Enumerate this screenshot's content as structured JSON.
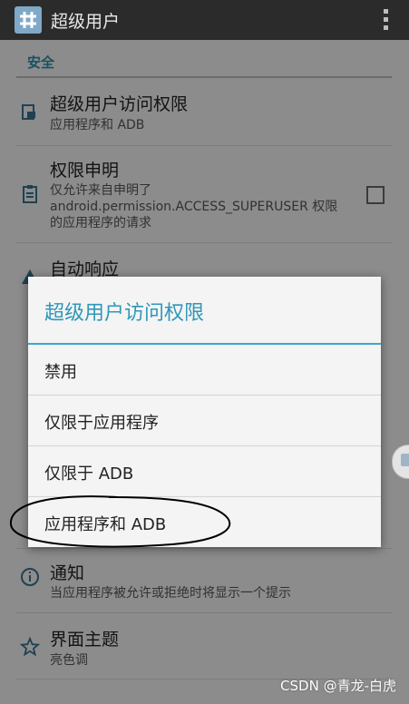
{
  "app_title": "超级用户",
  "section": "安全",
  "prefs": [
    {
      "title": "超级用户访问权限",
      "summary": "应用程序和 ADB"
    },
    {
      "title": "权限申明",
      "summary_lines": [
        "仅允许来自申明了",
        "android.permission.ACCESS_SUPERUSER 权限",
        "的应用程序的请求"
      ]
    },
    {
      "title": "自动响应"
    },
    {
      "title": "通知",
      "summary": "当应用程序被允许或拒绝时将显示一个提示"
    },
    {
      "title": "界面主题",
      "summary": "亮色调"
    }
  ],
  "dialog": {
    "title": "超级用户访问权限",
    "options": [
      "禁用",
      "仅限于应用程序",
      "仅限于 ADB",
      "应用程序和 ADB"
    ]
  },
  "watermark": "CSDN @青龙-白虎",
  "colors": {
    "accent": "#2f97b9",
    "actionbar": "#2b2b2b"
  }
}
